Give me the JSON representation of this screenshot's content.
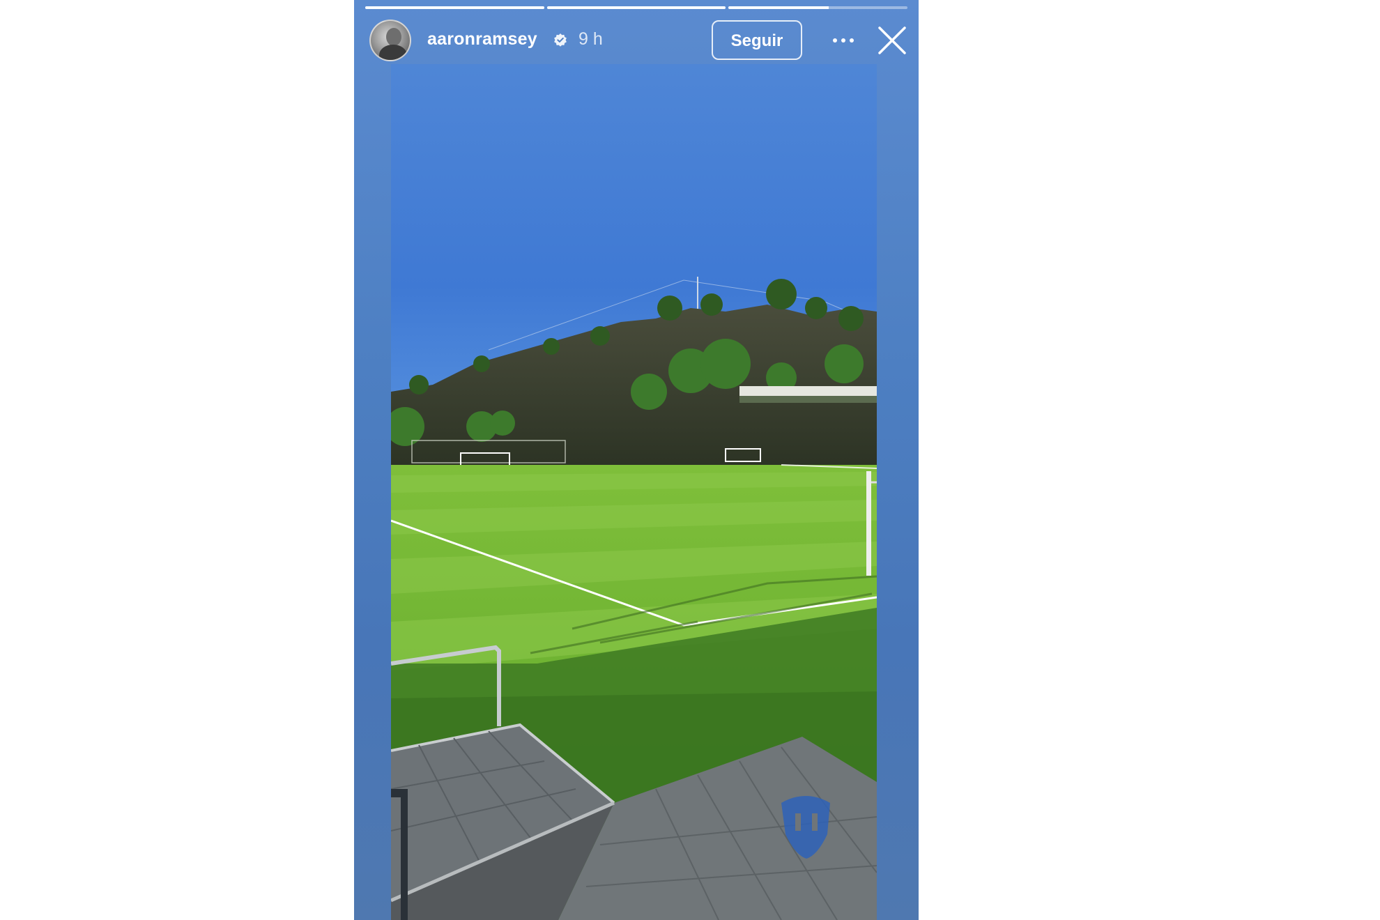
{
  "story": {
    "progress": [
      1,
      1,
      0.56
    ],
    "username": "aaronramsey",
    "verified_icon": "verified-badge-icon",
    "time": "9 h",
    "follow_label": "Seguir",
    "more_icon": "more-options-icon",
    "close_icon": "close-icon",
    "background_color": "#4d7fc2"
  }
}
